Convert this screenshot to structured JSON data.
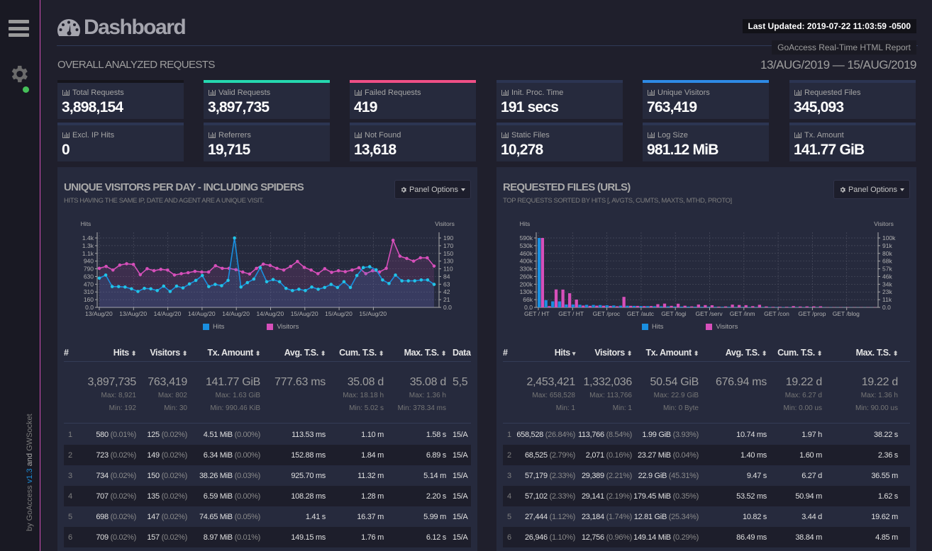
{
  "sidebar": {
    "menu_icon": "hamburger-menu-icon",
    "settings_icon": "gear-icon",
    "status": "connected",
    "status_color": "#45c059",
    "credits_prefix": "by GoAccess ",
    "credits_version": "v1.3",
    "credits_and": " and ",
    "credits_suffix": "GWSocket"
  },
  "header": {
    "title": "Dashboard",
    "title_icon": "dashboard-gauge-icon",
    "last_updated": "Last Updated: 2019-07-22 11:03:59 -0500",
    "report_label": "GoAccess Real-Time HTML Report"
  },
  "overall": {
    "section_title": "OVERALL ANALYZED REQUESTS",
    "date_range": "13/AUG/2019 — 15/AUG/2019",
    "cards": [
      {
        "label": "Total Requests",
        "value": "3,898,154",
        "accent": "#15151c"
      },
      {
        "label": "Valid Requests",
        "value": "3,897,735",
        "accent": "#25d8b0"
      },
      {
        "label": "Failed Requests",
        "value": "419",
        "accent": "#ef4f86"
      },
      {
        "label": "Init. Proc. Time",
        "value": "191 secs",
        "accent": "#2c3552"
      },
      {
        "label": "Unique Visitors",
        "value": "763,419",
        "accent": "#2e8ae6"
      },
      {
        "label": "Requested Files",
        "value": "345,093",
        "accent": "#2c3552"
      },
      {
        "label": "Excl. IP Hits",
        "value": "0",
        "accent": "#2c3552"
      },
      {
        "label": "Referrers",
        "value": "19,715",
        "accent": "#2c3552"
      },
      {
        "label": "Not Found",
        "value": "13,618",
        "accent": "#2c3552"
      },
      {
        "label": "Static Files",
        "value": "10,278",
        "accent": "#2c3552"
      },
      {
        "label": "Log Size",
        "value": "981.12 MiB",
        "accent": "#2c3552"
      },
      {
        "label": "Tx. Amount",
        "value": "141.77 GiB",
        "accent": "#2c3552"
      }
    ]
  },
  "panels": [
    {
      "title": "UNIQUE VISITORS PER DAY - INCLUDING SPIDERS",
      "subtitle": "HITS HAVING THE SAME IP, DATE AND AGENT ARE A UNIQUE VISIT.",
      "options_label": "Panel Options",
      "columns": [
        {
          "label": "#",
          "sort": ""
        },
        {
          "label": "Hits",
          "sort": "⬍"
        },
        {
          "label": "Visitors",
          "sort": "⬍"
        },
        {
          "label": "Tx. Amount",
          "sort": "⬍"
        },
        {
          "label": "Avg. T.S.",
          "sort": "⬍"
        },
        {
          "label": "Cum. T.S.",
          "sort": "⬍"
        },
        {
          "label": "Max. T.S.",
          "sort": "⬍"
        },
        {
          "label": "Data",
          "sort": ""
        }
      ],
      "summary": {
        "hits": {
          "total": "3,897,735",
          "max": "Max: 8,921",
          "min": "Min: 192"
        },
        "visitors": {
          "total": "763,419",
          "max": "Max: 802",
          "min": "Min: 30"
        },
        "tx": {
          "total": "141.77 GiB",
          "max": "Max: 1.63 GiB",
          "min": "Min: 990.46 KiB"
        },
        "avg": {
          "total": "777.63 ms"
        },
        "cum": {
          "total": "35.08 d",
          "max": "Max: 18.18 h",
          "min": "Min: 5.02 s"
        },
        "maxts": {
          "total": "35.08 d",
          "max": "Max: 1.36 h",
          "min": "Min: 378.34 ms"
        },
        "data": {
          "total": "5,5"
        }
      },
      "rows": [
        {
          "idx": "1",
          "hits": "580",
          "hits_pct": "(0.01%)",
          "visitors": "125",
          "visitors_pct": "(0.02%)",
          "tx": "4.51 MiB",
          "tx_pct": "(0.00%)",
          "avg": "113.53 ms",
          "cum": "1.10 m",
          "max": "1.58 s",
          "data": "15/A"
        },
        {
          "idx": "2",
          "hits": "723",
          "hits_pct": "(0.02%)",
          "visitors": "149",
          "visitors_pct": "(0.02%)",
          "tx": "6.34 MiB",
          "tx_pct": "(0.00%)",
          "avg": "152.88 ms",
          "cum": "1.84 m",
          "max": "6.89 s",
          "data": "15/A"
        },
        {
          "idx": "3",
          "hits": "734",
          "hits_pct": "(0.02%)",
          "visitors": "150",
          "visitors_pct": "(0.02%)",
          "tx": "38.26 MiB",
          "tx_pct": "(0.03%)",
          "avg": "925.70 ms",
          "cum": "11.32 m",
          "max": "5.14 m",
          "data": "15/A"
        },
        {
          "idx": "4",
          "hits": "707",
          "hits_pct": "(0.02%)",
          "visitors": "135",
          "visitors_pct": "(0.02%)",
          "tx": "6.59 MiB",
          "tx_pct": "(0.00%)",
          "avg": "108.28 ms",
          "cum": "1.28 m",
          "max": "2.20 s",
          "data": "15/A"
        },
        {
          "idx": "5",
          "hits": "698",
          "hits_pct": "(0.02%)",
          "visitors": "147",
          "visitors_pct": "(0.02%)",
          "tx": "74.65 MiB",
          "tx_pct": "(0.05%)",
          "avg": "1.41 s",
          "cum": "16.37 m",
          "max": "5.99 m",
          "data": "15/A"
        },
        {
          "idx": "6",
          "hits": "709",
          "hits_pct": "(0.02%)",
          "visitors": "157",
          "visitors_pct": "(0.02%)",
          "tx": "8.97 MiB",
          "tx_pct": "(0.01%)",
          "avg": "149.15 ms",
          "cum": "1.76 m",
          "max": "6.12 s",
          "data": "15/A"
        }
      ]
    },
    {
      "title": "REQUESTED FILES (URLS)",
      "subtitle": "TOP REQUESTS SORTED BY HITS [, AVGTS, CUMTS, MAXTS, MTHD, PROTO]",
      "options_label": "Panel Options",
      "columns": [
        {
          "label": "#",
          "sort": ""
        },
        {
          "label": "Hits",
          "sort": "▾"
        },
        {
          "label": "Visitors",
          "sort": "⬍"
        },
        {
          "label": "Tx. Amount",
          "sort": "⬍"
        },
        {
          "label": "Avg. T.S.",
          "sort": "⬍"
        },
        {
          "label": "Cum. T.S.",
          "sort": "⬍"
        },
        {
          "label": "Max. T.S.",
          "sort": "⬍"
        }
      ],
      "summary": {
        "hits": {
          "total": "2,453,421",
          "max": "Max: 658,528",
          "min": "Min: 1"
        },
        "visitors": {
          "total": "1,332,036",
          "max": "Max: 113,766",
          "min": "Min: 1"
        },
        "tx": {
          "total": "50.54 GiB",
          "max": "Max: 22.9 GiB",
          "min": "Min: 0 Byte"
        },
        "avg": {
          "total": "676.94 ms"
        },
        "cum": {
          "total": "19.22 d",
          "max": "Max: 6.27 d",
          "min": "Min: 0.00 us"
        },
        "maxts": {
          "total": "19.22 d",
          "max": "Max: 1.36 h",
          "min": "Min: 90.00 us"
        }
      },
      "rows": [
        {
          "idx": "1",
          "hits": "658,528",
          "hits_pct": "(26.84%)",
          "visitors": "113,766",
          "visitors_pct": "(8.54%)",
          "tx": "1.99 GiB",
          "tx_pct": "(3.93%)",
          "avg": "10.74 ms",
          "cum": "1.97 h",
          "max": "38.22 s"
        },
        {
          "idx": "2",
          "hits": "68,525",
          "hits_pct": "(2.79%)",
          "visitors": "2,071",
          "visitors_pct": "(0.16%)",
          "tx": "23.27 MiB",
          "tx_pct": "(0.04%)",
          "avg": "1.40 ms",
          "cum": "1.60 m",
          "max": "2.36 s"
        },
        {
          "idx": "3",
          "hits": "57,179",
          "hits_pct": "(2.33%)",
          "visitors": "29,389",
          "visitors_pct": "(2.21%)",
          "tx": "22.9 GiB",
          "tx_pct": "(45.31%)",
          "avg": "9.47 s",
          "cum": "6.27 d",
          "max": "36.55 m"
        },
        {
          "idx": "4",
          "hits": "57,102",
          "hits_pct": "(2.33%)",
          "visitors": "29,141",
          "visitors_pct": "(2.19%)",
          "tx": "179.45 MiB",
          "tx_pct": "(0.35%)",
          "avg": "53.52 ms",
          "cum": "50.94 m",
          "max": "1.62 s"
        },
        {
          "idx": "5",
          "hits": "27,444",
          "hits_pct": "(1.12%)",
          "visitors": "23,184",
          "visitors_pct": "(1.74%)",
          "tx": "12.81 GiB",
          "tx_pct": "(25.34%)",
          "avg": "10.82 s",
          "cum": "3.44 d",
          "max": "19.62 m"
        },
        {
          "idx": "6",
          "hits": "26,946",
          "hits_pct": "(1.10%)",
          "visitors": "12,756",
          "visitors_pct": "(0.96%)",
          "tx": "149.14 MiB",
          "tx_pct": "(0.29%)",
          "avg": "86.49 ms",
          "cum": "38.84 m",
          "max": "4.85 m"
        }
      ]
    }
  ],
  "chart_data": [
    {
      "type": "area",
      "title": "Unique visitors per day - including spiders",
      "ylabel": "Hits",
      "y2label": "Visitors",
      "xtick_labels": [
        "13/Aug/20",
        "13/Aug/20",
        "14/Aug/20",
        "14/Aug/20",
        "14/Aug/20",
        "14/Aug/20",
        "15/Aug/20",
        "15/Aug/20",
        "15/Aug/20"
      ],
      "yticks": [
        "0.0",
        "160",
        "310",
        "470",
        "630",
        "790",
        "940",
        "1.1k",
        "1.3k",
        "1.4k"
      ],
      "y2ticks": [
        "0.0",
        "21",
        "42",
        "63",
        "84",
        "110",
        "130",
        "150",
        "170",
        "190"
      ],
      "ylim": [
        0,
        1570
      ],
      "y2lim": [
        0,
        210
      ],
      "grid": true,
      "legend": "bottom",
      "series": [
        {
          "name": "Hits",
          "color": "#1a8fe0",
          "axis": "left",
          "values": [
            660,
            730,
            470,
            470,
            460,
            420,
            360,
            430,
            420,
            380,
            480,
            360,
            480,
            440,
            530,
            610,
            720,
            470,
            520,
            490,
            610,
            1570,
            460,
            560,
            640,
            900,
            580,
            630,
            580,
            430,
            380,
            410,
            380,
            460,
            410,
            450,
            520,
            450,
            580,
            450,
            720,
            900,
            920,
            850,
            620,
            540,
            730,
            600,
            600,
            600,
            620,
            620,
            520
          ]
        },
        {
          "name": "Visitors",
          "color": "#d64fba",
          "axis": "right",
          "values": [
            118,
            124,
            113,
            128,
            132,
            130,
            99,
            117,
            111,
            115,
            113,
            98,
            102,
            105,
            109,
            107,
            107,
            126,
            118,
            118,
            114,
            107,
            101,
            118,
            131,
            127,
            118,
            113,
            124,
            139,
            121,
            113,
            102,
            117,
            106,
            111,
            108,
            113,
            120,
            102,
            111,
            107,
            118,
            203,
            155,
            148,
            140,
            150,
            150,
            125
          ]
        }
      ]
    },
    {
      "type": "bar",
      "title": "Requested files (URLs)",
      "ylabel": "Hits",
      "y2label": "Visitors",
      "xtick_labels": [
        "GET / HT",
        "GET / HT",
        "GET /proc",
        "GET /autc",
        "GET /logi",
        "GET /serv",
        "GET /inm",
        "GET /con",
        "GET /prop",
        "GET /blog"
      ],
      "yticks": [
        "0.0",
        "66k",
        "130k",
        "200k",
        "260k",
        "330k",
        "400k",
        "460k",
        "530k",
        "590k"
      ],
      "y2ticks": [
        "0.0",
        "11k",
        "23k",
        "34k",
        "46k",
        "57k",
        "68k",
        "80k",
        "91k",
        "100k"
      ],
      "ylim": [
        0,
        658528
      ],
      "y2lim": [
        0,
        113766
      ],
      "grid": true,
      "legend": "bottom",
      "series": [
        {
          "name": "Hits",
          "color": "#1a8fe0",
          "axis": "left",
          "values": [
            658528,
            68525,
            57179,
            57102,
            27444,
            26946,
            25000,
            24000,
            23000,
            22000,
            20000,
            18000,
            16000,
            15000,
            14000,
            13000,
            12000,
            11000,
            10000,
            9000,
            8000,
            7500,
            7000,
            6500,
            6000,
            5500,
            5200,
            5000,
            4800,
            4600,
            4400,
            4200,
            4000,
            3800,
            3600,
            3400,
            3200,
            3000,
            2800,
            2600,
            2400,
            2200,
            2000,
            1800,
            1600,
            1500,
            1400,
            1300,
            1200,
            1100
          ]
        },
        {
          "name": "Visitors",
          "color": "#d64fba",
          "axis": "right",
          "values": [
            113766,
            2071,
            29389,
            29141,
            23184,
            12756,
            3000,
            2500,
            2800,
            2700,
            2400,
            1800,
            17200,
            2500,
            2400,
            2000,
            2200,
            5200,
            6200,
            2500,
            6000,
            2700,
            1600,
            4700,
            3700,
            3500,
            1200,
            1500,
            4500,
            3900,
            3600,
            2000,
            4200,
            1500,
            800,
            900,
            900,
            2100,
            1400,
            1600,
            1700,
            1700,
            400,
            400,
            400,
            400,
            300,
            300,
            300,
            300
          ]
        }
      ]
    }
  ]
}
